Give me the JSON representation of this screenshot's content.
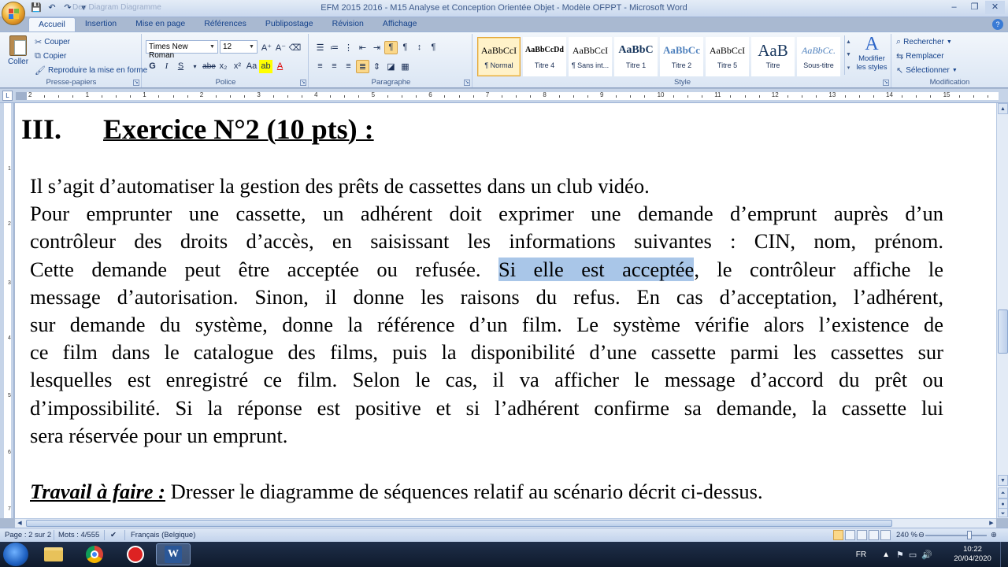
{
  "window": {
    "title": "EFM 2015 2016 - M15 Analyse et Conception Orientée Objet - Modèle OFPPT - Microsoft Word",
    "ghost_title": "Dev Diagram Diagramme",
    "controls": [
      "–",
      "❐",
      "✕"
    ]
  },
  "tabs": [
    "Accueil",
    "Insertion",
    "Mise en page",
    "Références",
    "Publipostage",
    "Révision",
    "Affichage"
  ],
  "ribbon": {
    "presse_papiers": {
      "label": "Presse-papiers",
      "paste": "Coller",
      "cut": "Couper",
      "copy": "Copier",
      "format_painter": "Reproduire la mise en forme"
    },
    "police": {
      "label": "Police",
      "font_name": "Times New Roman",
      "font_size": "12"
    },
    "paragraphe": {
      "label": "Paragraphe"
    },
    "style": {
      "label": "Style",
      "styles": [
        {
          "preview": "AaBbCcI",
          "name": "¶ Normal"
        },
        {
          "preview": "AaBbCcDd",
          "name": "Titre 4"
        },
        {
          "preview": "AaBbCcI",
          "name": "¶ Sans int..."
        },
        {
          "preview": "AaBbC",
          "name": "Titre 1"
        },
        {
          "preview": "AaBbCc",
          "name": "Titre 2"
        },
        {
          "preview": "AaBbCcI",
          "name": "Titre 5"
        },
        {
          "preview": "AaB",
          "name": "Titre"
        },
        {
          "preview": "AaBbCc.",
          "name": "Sous-titre"
        }
      ],
      "modify": "Modifier les styles"
    },
    "modification": {
      "label": "Modification",
      "find": "Rechercher",
      "replace": "Remplacer",
      "select": "Sélectionner"
    }
  },
  "document": {
    "heading_number": "III.",
    "heading_text": "Exercice N°2 (10 pts) :",
    "lines": [
      "Il s’agit d’automatiser la gestion des prêts de cassettes dans un club vidéo.",
      "Pour emprunter une cassette, un adhérent doit exprimer une demande d’emprunt auprès d’un",
      "contrôleur des droits d’accès, en saisissant les informations suivantes : CIN, nom, prénom.",
      "Cette demande peut être acceptée ou refusée. ",
      "message d’autorisation. Sinon, il donne les raisons du refus. En cas d’acceptation, l’adhérent,",
      "sur demande du système, donne la référence d’un film. Le système vérifie alors l’existence de",
      "ce film dans le catalogue des films, puis la disponibilité d’une cassette parmi les cassettes sur",
      "lesquelles est enregistré ce film. Selon le cas, il va afficher le message d’accord du prêt ou",
      "d’impossibilité. Si la réponse est positive et si l’adhérent confirme sa demande, la cassette lui",
      "sera réservée pour un emprunt."
    ],
    "highlighted": "Si elle est acceptée",
    "line4_after": ", le contrôleur affiche le",
    "task_label": "Travail à faire :",
    "task_text": " Dresser le diagramme de séquences relatif au scénario décrit ci-dessus."
  },
  "statusbar": {
    "page": "Page : 2 sur 2",
    "words": "Mots : 4/555",
    "language": "Français (Belgique)",
    "zoom": "240 %"
  },
  "taskbar": {
    "lang": "FR",
    "time": "10:22",
    "date": "20/04/2020"
  },
  "ruler": {
    "numbers": [
      "2",
      "1",
      "1",
      "2",
      "3",
      "4",
      "5",
      "6",
      "7",
      "8",
      "9",
      "10",
      "11",
      "12",
      "13",
      "14",
      "15"
    ]
  }
}
